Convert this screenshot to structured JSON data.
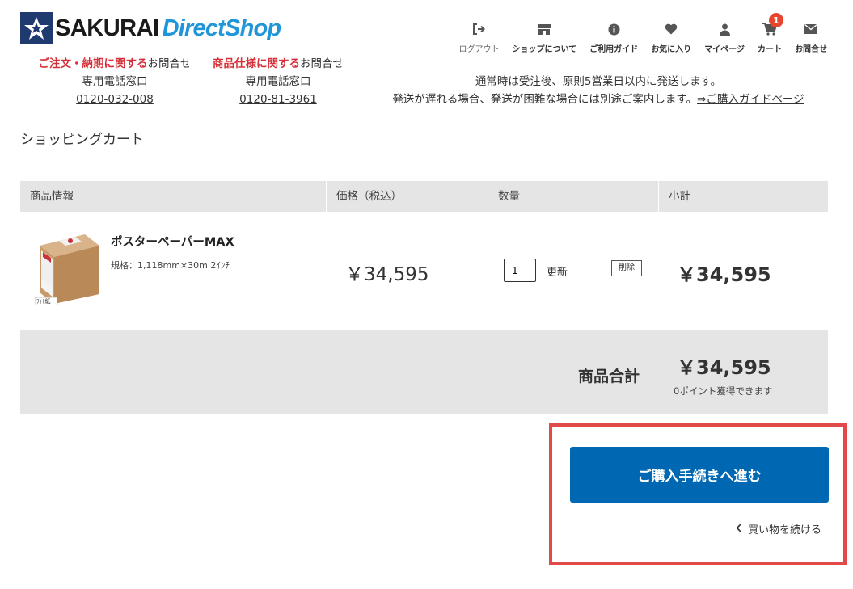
{
  "logo": {
    "brand": "SAKURAI",
    "shop": "DirectShop"
  },
  "nav": [
    {
      "label": "ログアウト",
      "icon": "logout-icon"
    },
    {
      "label": "ショップについて",
      "icon": "store-icon"
    },
    {
      "label": "ご利用ガイド",
      "icon": "info-icon"
    },
    {
      "label": "お気に入り",
      "icon": "heart-icon"
    },
    {
      "label": "マイページ",
      "icon": "user-icon"
    },
    {
      "label": "カート",
      "icon": "cart-icon",
      "badge": "1"
    },
    {
      "label": "お問合せ",
      "icon": "mail-icon"
    }
  ],
  "contact": [
    {
      "prefix": "ご注文・納期に関する",
      "suffix": "お問合せ",
      "sub": "専用電話窓口",
      "tel": "0120-032-008"
    },
    {
      "prefix": "商品仕様に関する",
      "suffix": "お問合せ",
      "sub": "専用電話窓口",
      "tel": "0120-81-3961"
    }
  ],
  "shipping": {
    "line1": "通常時は受注後、原則5営業日以内に発送します。",
    "line2": "発送が遅れる場合、発送が困難な場合には別途ご案内します。",
    "link": "⇒ご購入ガイドページ"
  },
  "page_title": "ショッピングカート",
  "table": {
    "headers": [
      "商品情報",
      "価格（税込）",
      "数量",
      "小計"
    ]
  },
  "item": {
    "name": "ポスターペーパーMAX",
    "spec": "規格：1,118mm×30m 2ｲﾝﾁ",
    "image_label": "ﾌｫﾄ紙",
    "price": "￥34,595",
    "quantity": "1",
    "update_label": "更新",
    "delete_label": "削除",
    "subtotal": "￥34,595"
  },
  "summary": {
    "total_label": "商品合計",
    "total_value": "￥34,595",
    "points": "0ポイント獲得できます"
  },
  "actions": {
    "checkout": "ご購入手続きへ進む",
    "continue": "買い物を続ける"
  },
  "colors": {
    "accent": "#0068b3",
    "highlight": "#e24a4a",
    "red": "#d6313a",
    "badge": "#e8452f"
  }
}
